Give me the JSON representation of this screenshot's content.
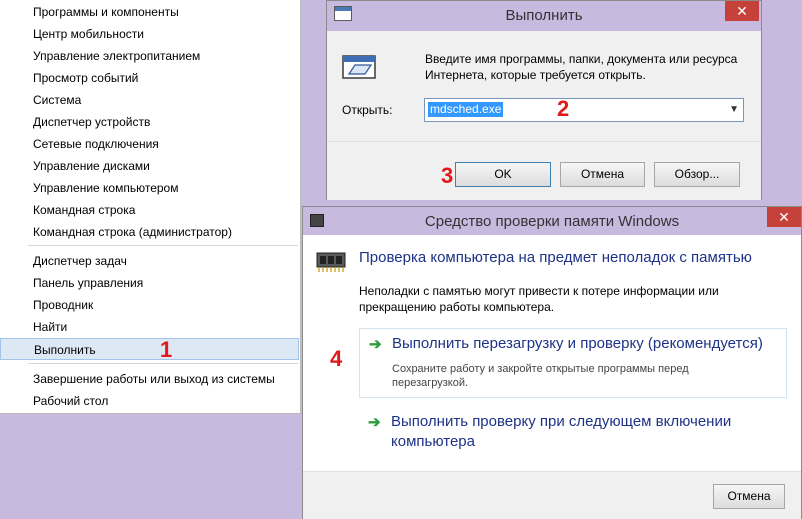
{
  "winx_menu": {
    "group1": [
      "Программы и компоненты",
      "Центр мобильности",
      "Управление электропитанием",
      "Просмотр событий",
      "Система",
      "Диспетчер устройств",
      "Сетевые подключения",
      "Управление дисками",
      "Управление компьютером",
      "Командная строка",
      "Командная строка (администратор)"
    ],
    "group2": [
      "Диспетчер задач",
      "Панель управления",
      "Проводник",
      "Найти",
      "Выполнить"
    ],
    "group3": [
      "Завершение работы или выход из системы",
      "Рабочий стол"
    ],
    "selected": "Выполнить"
  },
  "annotations": {
    "step1": "1",
    "step2": "2",
    "step3": "3",
    "step4": "4"
  },
  "run_dialog": {
    "title": "Выполнить",
    "close_glyph": "✕",
    "description": "Введите имя программы, папки, документа или ресурса Интернета, которые требуется открыть.",
    "open_label": "Открыть:",
    "open_value": "mdsched.exe",
    "dropdown_glyph": "▼",
    "ok_label": "OK",
    "cancel_label": "Отмена",
    "browse_label": "Обзор..."
  },
  "memory_dialog": {
    "title": "Средство проверки памяти Windows",
    "close_glyph": "✕",
    "heading": "Проверка компьютера на предмет неполадок с памятью",
    "info": "Неполадки с памятью могут привести к потере информации или прекращению работы компьютера.",
    "option1_title": "Выполнить перезагрузку и проверку (рекомендуется)",
    "option1_sub": "Сохраните работу и закройте открытые программы перед перезагрузкой.",
    "option2_title": "Выполнить проверку при следующем включении компьютера",
    "arrow_glyph": "➔",
    "cancel_label": "Отмена"
  },
  "colors": {
    "accent_link": "#1e3287",
    "annotation_red": "#e01a1a",
    "selection": "#3399ff",
    "close_red": "#c7413b",
    "desktop": "#c8b9df"
  }
}
